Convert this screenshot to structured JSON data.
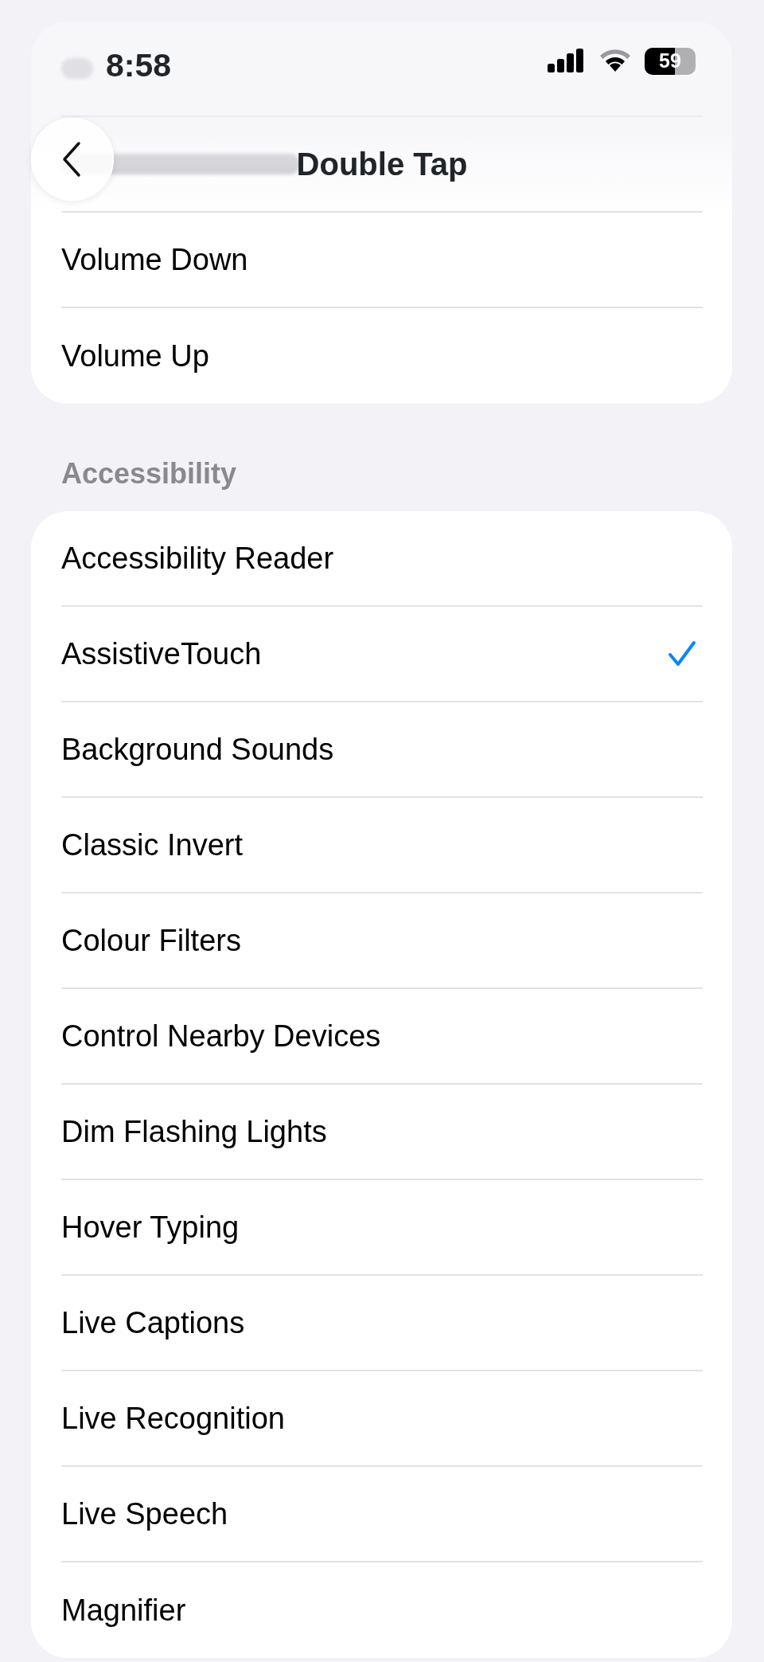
{
  "status_bar": {
    "time": "8:58",
    "battery": "59"
  },
  "nav": {
    "title": "Double Tap"
  },
  "sections": [
    {
      "items": [
        {
          "label": "Volume Down",
          "selected": false
        },
        {
          "label": "Volume Up",
          "selected": false
        }
      ]
    },
    {
      "header": "Accessibility",
      "items": [
        {
          "label": "Accessibility Reader",
          "selected": false
        },
        {
          "label": "AssistiveTouch",
          "selected": true
        },
        {
          "label": "Background Sounds",
          "selected": false
        },
        {
          "label": "Classic Invert",
          "selected": false
        },
        {
          "label": "Colour Filters",
          "selected": false
        },
        {
          "label": "Control Nearby Devices",
          "selected": false
        },
        {
          "label": "Dim Flashing Lights",
          "selected": false
        },
        {
          "label": "Hover Typing",
          "selected": false
        },
        {
          "label": "Live Captions",
          "selected": false
        },
        {
          "label": "Live Recognition",
          "selected": false
        },
        {
          "label": "Live Speech",
          "selected": false
        },
        {
          "label": "Magnifier",
          "selected": false
        }
      ]
    }
  ]
}
